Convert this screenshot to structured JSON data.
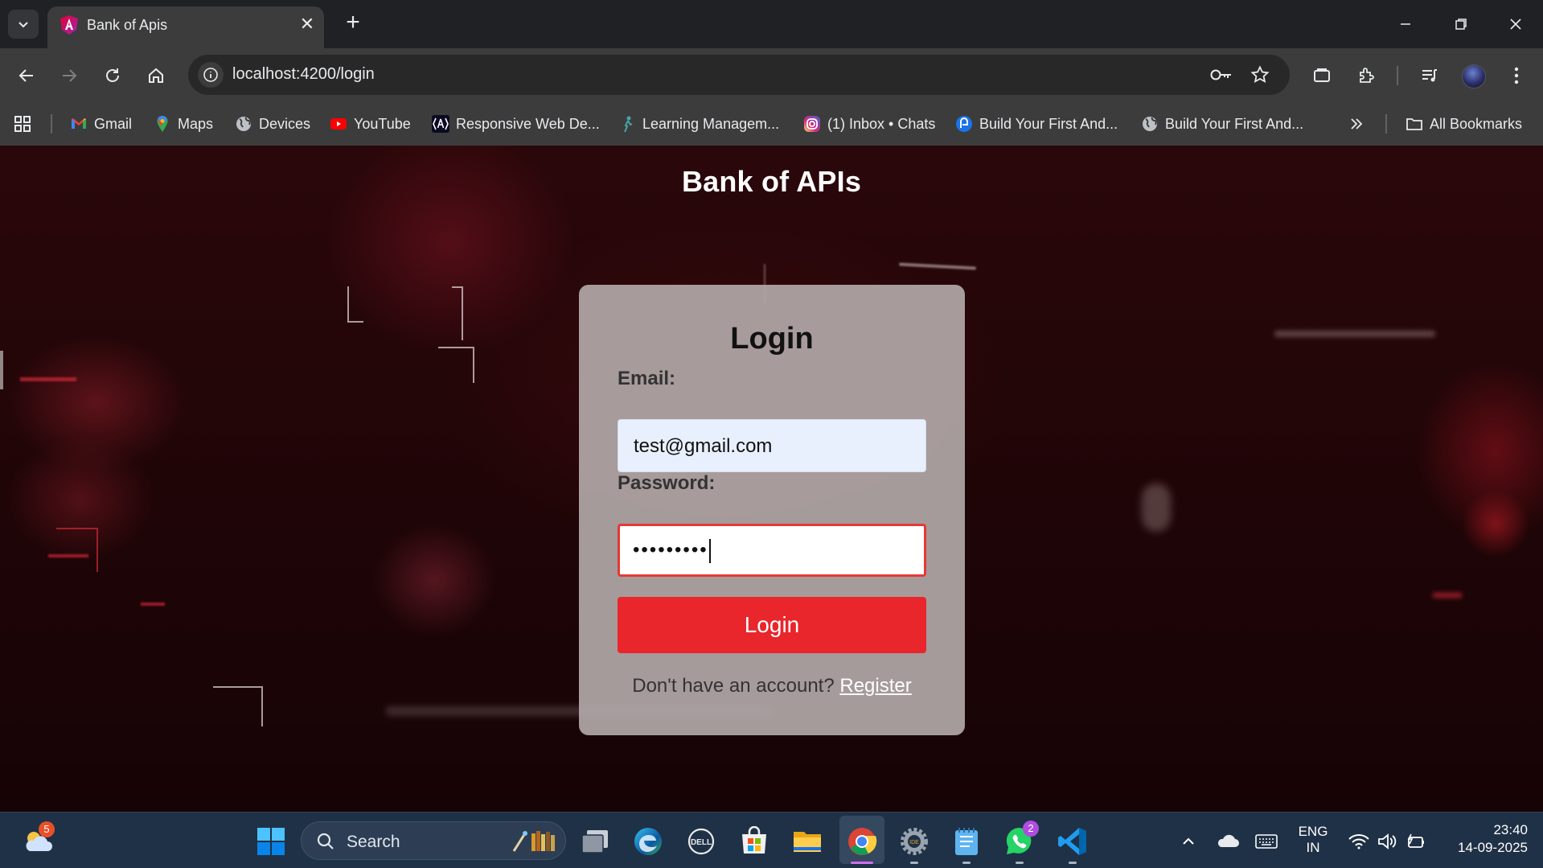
{
  "browser": {
    "tab": {
      "title": "Bank of Apis"
    },
    "url": "localhost:4200/login",
    "bookmarks": [
      {
        "label": "Gmail",
        "icon": "gmail-icon"
      },
      {
        "label": "Maps",
        "icon": "maps-icon"
      },
      {
        "label": "Devices",
        "icon": "globe-icon"
      },
      {
        "label": "YouTube",
        "icon": "youtube-icon"
      },
      {
        "label": "Responsive Web De...",
        "icon": "angular-icon"
      },
      {
        "label": "Learning Managem...",
        "icon": "learning-icon"
      },
      {
        "label": "(1) Inbox • Chats",
        "icon": "instagram-icon"
      },
      {
        "label": "Build Your First And...",
        "icon": "android-icon"
      },
      {
        "label": "Build Your First And...",
        "icon": "globe-icon"
      }
    ],
    "all_bookmarks": "All Bookmarks"
  },
  "page": {
    "app_title": "Bank of APIs",
    "login": {
      "heading": "Login",
      "email_label": "Email:",
      "email_value": "test@gmail.com",
      "password_label": "Password:",
      "password_mask": "•••••••••",
      "button": "Login",
      "register_prompt": "Don't have an account?",
      "register_link": "Register"
    }
  },
  "taskbar": {
    "weather_badge": "5",
    "search_label": "Search",
    "whatsapp_badge": "2",
    "lang_line1": "ENG",
    "lang_line2": "IN",
    "time": "23:40",
    "date": "14-09-2025"
  },
  "colors": {
    "login_button": "#e8262b",
    "password_border": "#e53935",
    "email_bg": "#e8f0fe",
    "card_bg": "#b2a8a8"
  }
}
